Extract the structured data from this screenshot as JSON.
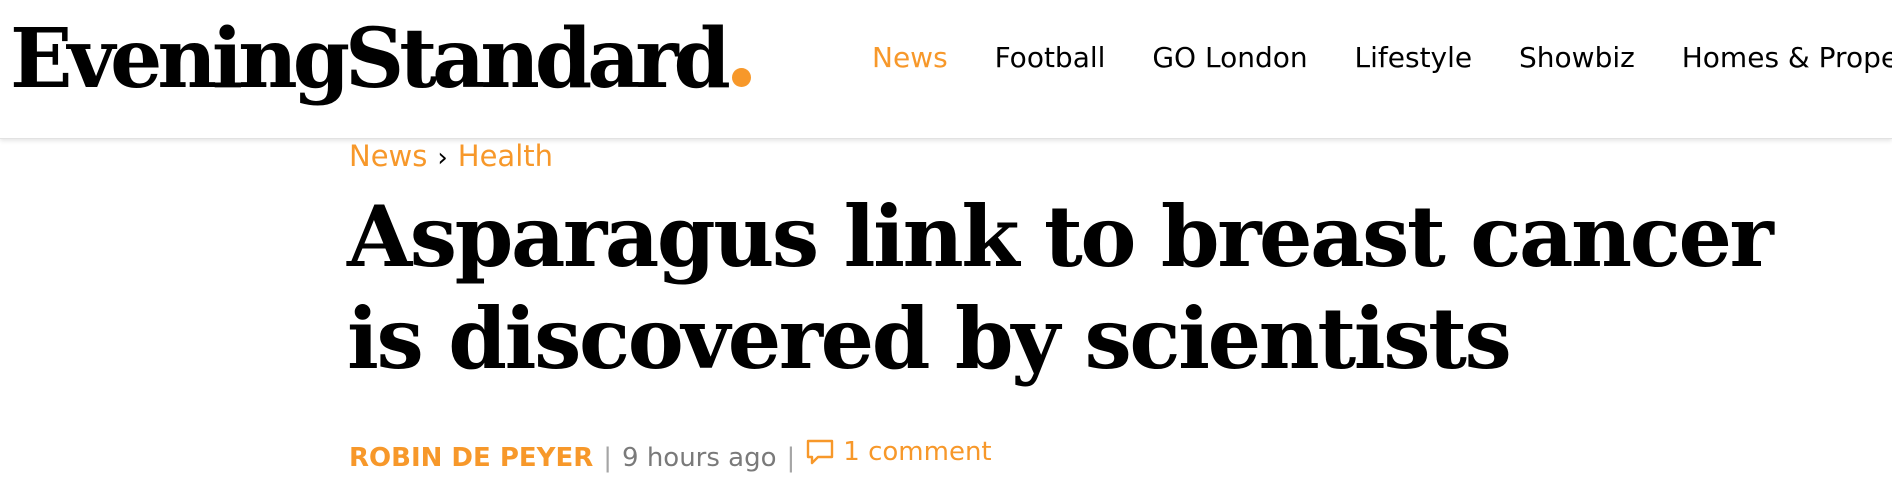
{
  "colors": {
    "accent": "#f7982a",
    "text": "#000000",
    "muted": "#7a7a7a"
  },
  "header": {
    "logo_text": "EveningStandard",
    "nav": [
      {
        "label": "News",
        "active": true
      },
      {
        "label": "Football",
        "active": false
      },
      {
        "label": "GO London",
        "active": false
      },
      {
        "label": "Lifestyle",
        "active": false
      },
      {
        "label": "Showbiz",
        "active": false
      },
      {
        "label": "Homes & Property",
        "active": false
      }
    ]
  },
  "breadcrumb": {
    "items": [
      "News",
      "Health"
    ],
    "separator": "›"
  },
  "article": {
    "headline": "Asparagus link to breast cancer is discovered by scientists",
    "author": "ROBIN DE PEYER",
    "byline_separator": "|",
    "time": "9 hours ago",
    "comments_label": "1 comment",
    "comments_icon": "comment-bubble-icon"
  }
}
